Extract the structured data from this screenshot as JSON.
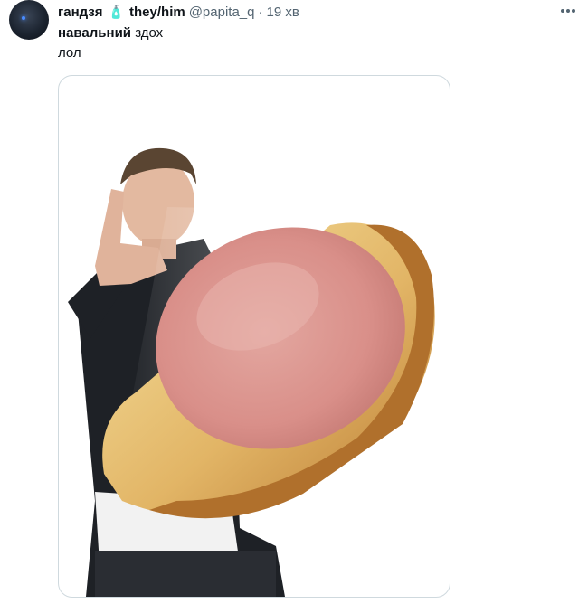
{
  "tweet": {
    "author_name": "гандзя",
    "pride_emoji": "🧴",
    "pronouns": "they/him",
    "handle": "@papita_q",
    "separator": "·",
    "time": "19 хв",
    "line1_bold": "навальний",
    "line1_rest": " здох",
    "line2": "лол"
  },
  "icons": {
    "avatar": "user-avatar",
    "more": "more-dots-icon"
  },
  "colors": {
    "text": "#0f1419",
    "secondary": "#536471",
    "border": "#cfd9de"
  }
}
